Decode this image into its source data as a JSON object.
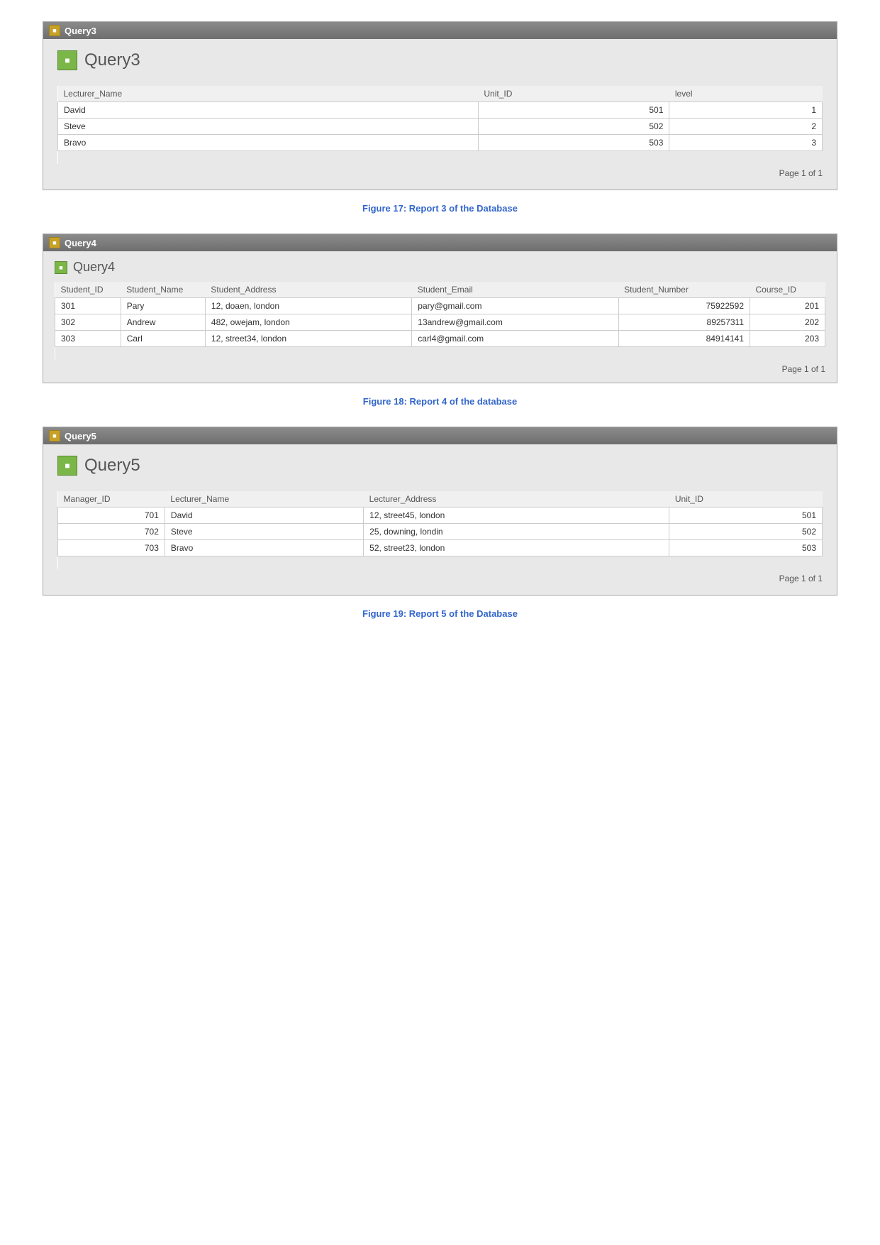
{
  "query3": {
    "window_title": "Query3",
    "report_title": "Query3",
    "columns": [
      "Lecturer_Name",
      "Unit_ID",
      "level"
    ],
    "rows": [
      {
        "name": "David",
        "unit_id": "501",
        "level": "1"
      },
      {
        "name": "Steve",
        "unit_id": "502",
        "level": "2"
      },
      {
        "name": "Bravo",
        "unit_id": "503",
        "level": "3"
      }
    ],
    "pagination": "Page 1 of 1",
    "caption": "Figure 17: Report 3 of the Database"
  },
  "query4": {
    "window_title": "Query4",
    "report_title": "Query4",
    "columns": [
      "Student_ID",
      "Student_Name",
      "Student_Address",
      "Student_Email",
      "Student_Number",
      "Course_ID"
    ],
    "rows": [
      {
        "student_id": "301",
        "student_name": "Pary",
        "student_address": "12, doaen, london",
        "student_email": "pary@gmail.com",
        "student_number": "75922592",
        "course_id": "201"
      },
      {
        "student_id": "302",
        "student_name": "Andrew",
        "student_address": "482, owejam, london",
        "student_email": "13andrew@gmail.com",
        "student_number": "89257311",
        "course_id": "202"
      },
      {
        "student_id": "303",
        "student_name": "Carl",
        "student_address": "12, street34, london",
        "student_email": "carl4@gmail.com",
        "student_number": "84914141",
        "course_id": "203"
      }
    ],
    "pagination": "Page 1 of 1",
    "caption": "Figure 18: Report 4 of the database"
  },
  "query5": {
    "window_title": "Query5",
    "report_title": "Query5",
    "columns": [
      "Manager_ID",
      "Lecturer_Name",
      "Lecturer_Address",
      "Unit_ID"
    ],
    "rows": [
      {
        "manager_id": "701",
        "lecturer_name": "David",
        "lecturer_address": "12, street45, london",
        "unit_id": "501"
      },
      {
        "manager_id": "702",
        "lecturer_name": "Steve",
        "lecturer_address": "25, downing, londin",
        "unit_id": "502"
      },
      {
        "manager_id": "703",
        "lecturer_name": "Bravo",
        "lecturer_address": "52, street23, london",
        "unit_id": "503"
      }
    ],
    "pagination": "Page 1 of 1",
    "caption": "Figure 19: Report 5 of the Database"
  }
}
